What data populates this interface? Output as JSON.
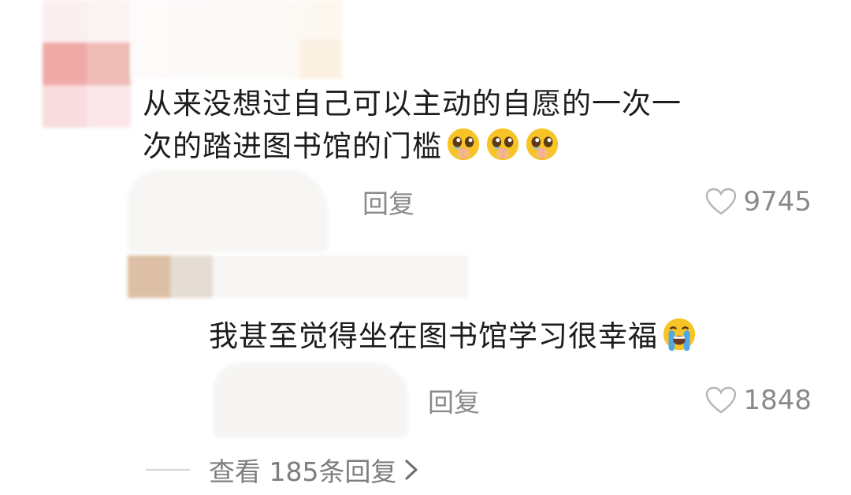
{
  "comments": [
    {
      "text_line1": "从来没想过自己可以主动的自愿的一次一",
      "text_line2": "次的踏进图书馆的门槛",
      "emoji": [
        "pleading-face-icon",
        "pleading-face-icon",
        "pleading-face-icon"
      ],
      "reply_label": "回复",
      "likes": "9745"
    },
    {
      "text": "我甚至觉得坐在图书馆学习很幸福",
      "emoji": [
        "loudly-crying-face-icon"
      ],
      "reply_label": "回复",
      "likes": "1848"
    }
  ],
  "view_replies": "查看 185条回复",
  "colors": {
    "meta_gray": "#8a8a8a",
    "text": "#1c1c1c",
    "emoji_yellow": "#f7c325",
    "tear_blue": "#4fa7e8"
  }
}
